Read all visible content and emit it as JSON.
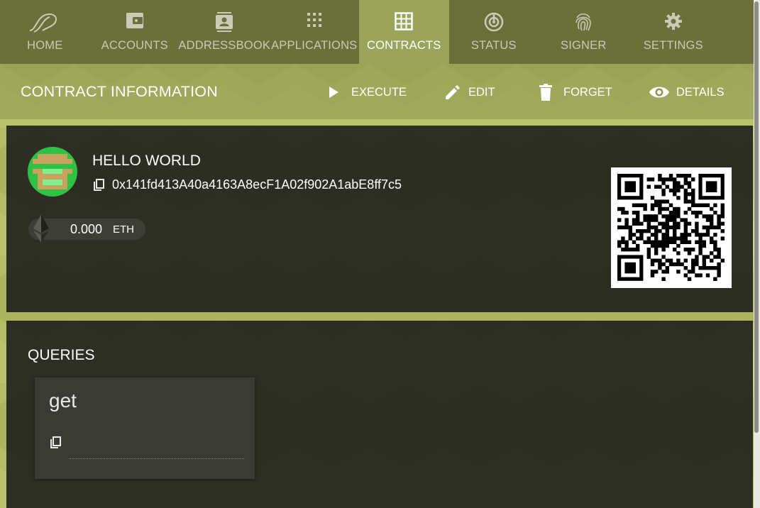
{
  "nav": {
    "tabs": [
      {
        "id": "home",
        "label": "HOME",
        "icon": "parity-logo-icon"
      },
      {
        "id": "accounts",
        "label": "ACCOUNTS",
        "icon": "wallet-icon"
      },
      {
        "id": "addressbook",
        "label": "ADDRESSBOOK",
        "icon": "contacts-icon"
      },
      {
        "id": "applications",
        "label": "APPLICATIONS",
        "icon": "apps-grid-icon"
      },
      {
        "id": "contracts",
        "label": "CONTRACTS",
        "icon": "grid-table-icon"
      },
      {
        "id": "status",
        "label": "STATUS",
        "icon": "radar-icon"
      },
      {
        "id": "signer",
        "label": "SIGNER",
        "icon": "fingerprint-icon"
      },
      {
        "id": "settings",
        "label": "SETTINGS",
        "icon": "gear-icon"
      }
    ],
    "active": "contracts"
  },
  "titlebar": {
    "title": "CONTRACT INFORMATION",
    "actions": [
      {
        "id": "execute",
        "label": "EXECUTE",
        "icon": "play-icon"
      },
      {
        "id": "edit",
        "label": "EDIT",
        "icon": "pencil-icon"
      },
      {
        "id": "forget",
        "label": "FORGET",
        "icon": "trash-icon"
      },
      {
        "id": "details",
        "label": "DETAILS",
        "icon": "eye-icon"
      }
    ]
  },
  "contract": {
    "name": "HELLO WORLD",
    "address": "0x141fd413A40a4163A8ecF1A02f902A1abE8ff7c5",
    "balance": {
      "value": "0.000",
      "unit": "ETH",
      "icon": "ethereum-icon"
    }
  },
  "queries": {
    "title": "QUERIES",
    "items": [
      {
        "name": "get",
        "value": "",
        "icon": "copy-icon"
      }
    ]
  },
  "colors": {
    "nav_bg": "#6b6f3a",
    "nav_active": "#9aa45b",
    "accent_green": "#b3bd66",
    "card_bg": "#28291f"
  }
}
